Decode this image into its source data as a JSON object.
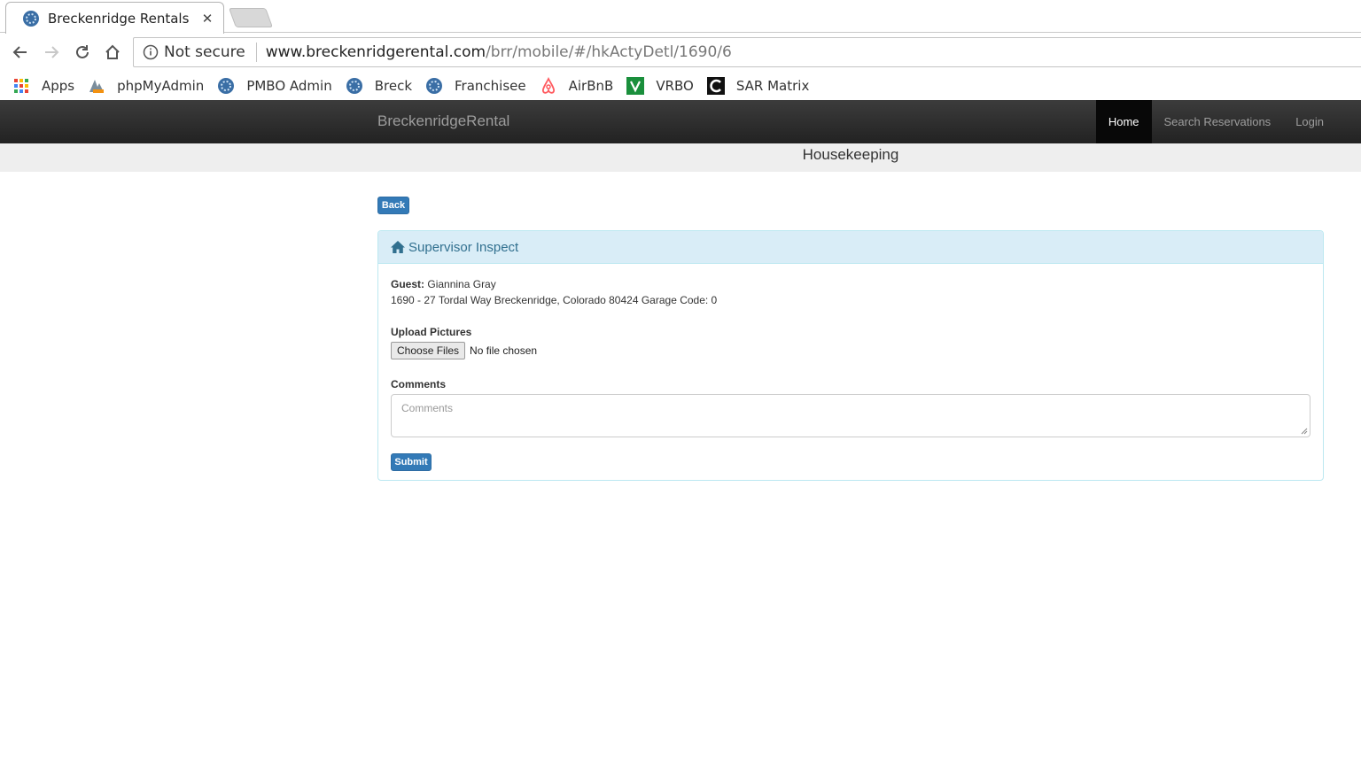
{
  "browser": {
    "tab": {
      "title": "Breckenridge Rentals",
      "close": "✕"
    },
    "address": {
      "security": "Not secure",
      "host": "www.breckenridgerental.com",
      "path": "/brr/mobile/#/hkActyDetl/1690/6"
    },
    "bookmarks": [
      {
        "label": "Apps",
        "icon": "apps-grid-icon"
      },
      {
        "label": "phpMyAdmin",
        "icon": "phpmyadmin-icon"
      },
      {
        "label": "PMBO Admin",
        "icon": "globe-icon"
      },
      {
        "label": "Breck",
        "icon": "globe-icon"
      },
      {
        "label": "Franchisee",
        "icon": "globe-icon"
      },
      {
        "label": "AirBnB",
        "icon": "airbnb-icon"
      },
      {
        "label": "VRBO",
        "icon": "vrbo-icon"
      },
      {
        "label": "SAR Matrix",
        "icon": "matrix-icon"
      }
    ]
  },
  "navbar": {
    "brand": "BreckenridgeRental",
    "links": [
      {
        "label": "Home",
        "active": true
      },
      {
        "label": "Search Reservations",
        "active": false
      },
      {
        "label": "Login",
        "active": false
      }
    ]
  },
  "page": {
    "header": "Housekeeping",
    "back_label": "Back",
    "panel": {
      "title": "Supervisor Inspect",
      "guest_label": "Guest:",
      "guest_name": "Giannina Gray",
      "address": "1690 - 27 Tordal Way Breckenridge, Colorado 80424 Garage Code: 0",
      "upload_label": "Upload Pictures",
      "choose_files": "Choose Files",
      "no_file": "No file chosen",
      "comments_label": "Comments",
      "comments_placeholder": "Comments",
      "submit_label": "Submit"
    }
  },
  "colors": {
    "primary": "#337ab7",
    "panel_heading_bg": "#d9edf7",
    "panel_heading_text": "#31708f",
    "navbar_bg": "#222222"
  }
}
